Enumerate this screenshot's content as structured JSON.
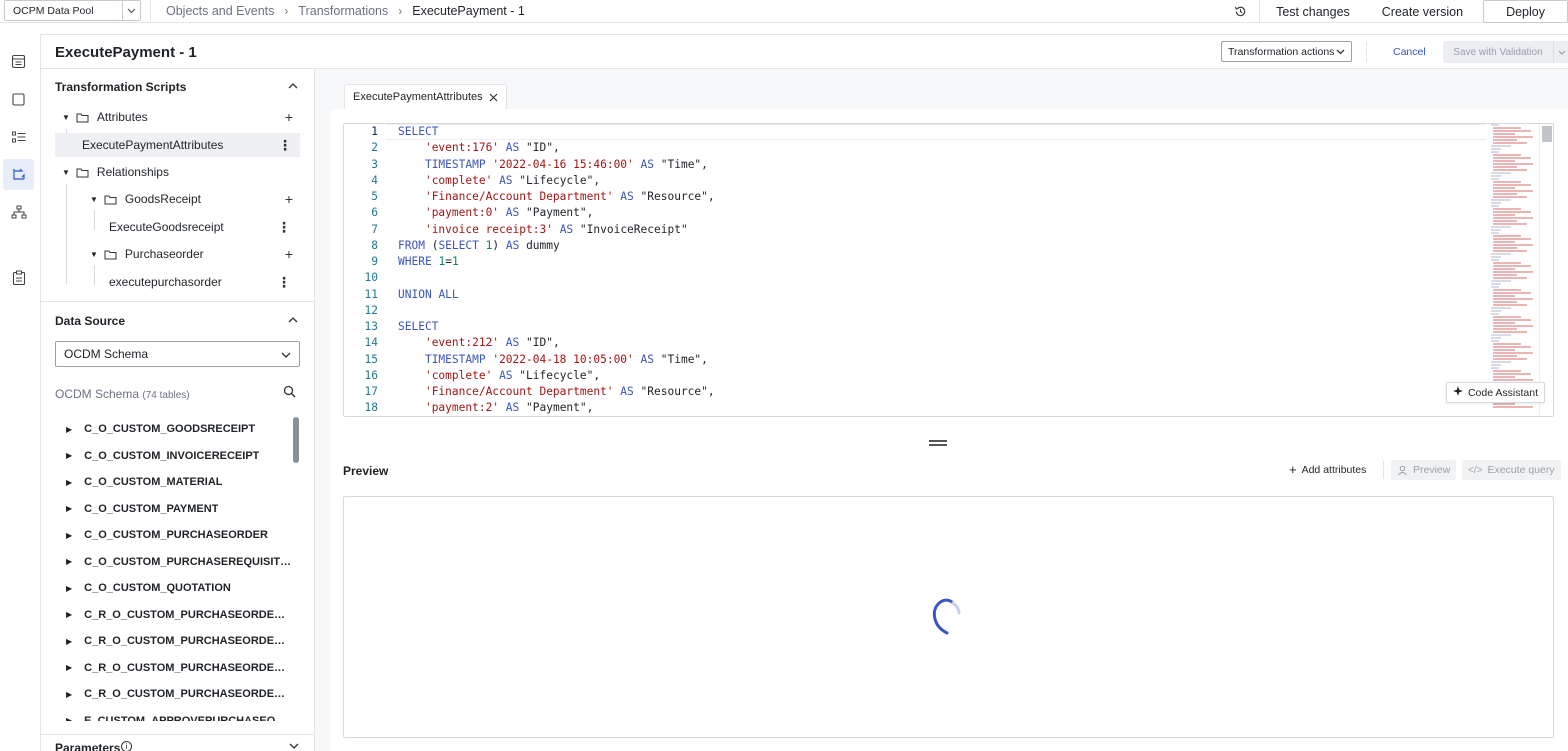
{
  "topbar": {
    "pool": "OCPM Data Pool",
    "breadcrumbs": [
      "Objects and Events",
      "Transformations",
      "ExecutePayment - 1"
    ],
    "actions": {
      "test": "Test changes",
      "create": "Create version",
      "deploy": "Deploy"
    }
  },
  "header": {
    "title": "ExecutePayment - 1",
    "transformation_actions": "Transformation actions",
    "cancel": "Cancel",
    "save": "Save with Validation"
  },
  "sidebar": {
    "scripts_title": "Transformation Scripts",
    "tree": {
      "attributes": "Attributes",
      "attr_item": "ExecutePaymentAttributes",
      "relationships": "Relationships",
      "goods_receipt": "GoodsReceipt",
      "goods_item": "ExecuteGoodsreceipt",
      "purchase_order": "Purchaseorder",
      "po_item": "executepurchasorder"
    },
    "data_source_title": "Data Source",
    "schema_select": "OCDM Schema",
    "schema_name": "OCDM Schema",
    "schema_count": "(74 tables)",
    "tables": [
      "C_O_CUSTOM_GOODSRECEIPT",
      "C_O_CUSTOM_INVOICERECEIPT",
      "C_O_CUSTOM_MATERIAL",
      "C_O_CUSTOM_PAYMENT",
      "C_O_CUSTOM_PURCHASEORDER",
      "C_O_CUSTOM_PURCHASEREQUISITI...",
      "C_O_CUSTOM_QUOTATION",
      "C_R_O_CUSTOM_PURCHASEORDER_...",
      "C_R_O_CUSTOM_PURCHASEORDER_...",
      "C_R_O_CUSTOM_PURCHASEORDER_...",
      "C_R_O_CUSTOM_PURCHASEORDER_...",
      "E_CUSTOM_APPROVEPURCHASEOR..."
    ],
    "parameters_title": "Parameters"
  },
  "editor": {
    "tab": "ExecutePaymentAttributes",
    "line_numbers": [
      "1",
      "2",
      "3",
      "4",
      "5",
      "6",
      "7",
      "8",
      "9",
      "10",
      "11",
      "12",
      "13",
      "14",
      "15",
      "16",
      "17",
      "18"
    ],
    "lines": [
      [
        {
          "t": "SELECT",
          "c": "kw"
        }
      ],
      [
        {
          "t": "    ",
          "c": ""
        },
        {
          "t": "'event:176'",
          "c": "str"
        },
        {
          "t": " ",
          "c": ""
        },
        {
          "t": "AS",
          "c": "kw"
        },
        {
          "t": " \"ID\",",
          "c": ""
        }
      ],
      [
        {
          "t": "    ",
          "c": ""
        },
        {
          "t": "TIMESTAMP",
          "c": "kw"
        },
        {
          "t": " ",
          "c": ""
        },
        {
          "t": "'2022-04-16 15:46:00'",
          "c": "str"
        },
        {
          "t": " ",
          "c": ""
        },
        {
          "t": "AS",
          "c": "kw"
        },
        {
          "t": " \"Time\",",
          "c": ""
        }
      ],
      [
        {
          "t": "    ",
          "c": ""
        },
        {
          "t": "'complete'",
          "c": "str"
        },
        {
          "t": " ",
          "c": ""
        },
        {
          "t": "AS",
          "c": "kw"
        },
        {
          "t": " \"Lifecycle\",",
          "c": ""
        }
      ],
      [
        {
          "t": "    ",
          "c": ""
        },
        {
          "t": "'Finance/Account Department'",
          "c": "str"
        },
        {
          "t": " ",
          "c": ""
        },
        {
          "t": "AS",
          "c": "kw"
        },
        {
          "t": " \"Resource\",",
          "c": ""
        }
      ],
      [
        {
          "t": "    ",
          "c": ""
        },
        {
          "t": "'payment:0'",
          "c": "str"
        },
        {
          "t": " ",
          "c": ""
        },
        {
          "t": "AS",
          "c": "kw"
        },
        {
          "t": " \"Payment\",",
          "c": ""
        }
      ],
      [
        {
          "t": "    ",
          "c": ""
        },
        {
          "t": "'invoice receipt:3'",
          "c": "str"
        },
        {
          "t": " ",
          "c": ""
        },
        {
          "t": "AS",
          "c": "kw"
        },
        {
          "t": " \"InvoiceReceipt\"",
          "c": ""
        }
      ],
      [
        {
          "t": "FROM",
          "c": "kw"
        },
        {
          "t": " (",
          "c": ""
        },
        {
          "t": "SELECT",
          "c": "kw"
        },
        {
          "t": " ",
          "c": ""
        },
        {
          "t": "1",
          "c": "num"
        },
        {
          "t": ") ",
          "c": ""
        },
        {
          "t": "AS",
          "c": "kw"
        },
        {
          "t": " dummy",
          "c": ""
        }
      ],
      [
        {
          "t": "WHERE",
          "c": "kw"
        },
        {
          "t": " ",
          "c": ""
        },
        {
          "t": "1",
          "c": "num"
        },
        {
          "t": "=",
          "c": ""
        },
        {
          "t": "1",
          "c": "num"
        }
      ],
      [],
      [
        {
          "t": "UNION",
          "c": "kw"
        },
        {
          "t": " ",
          "c": ""
        },
        {
          "t": "ALL",
          "c": "kw"
        }
      ],
      [],
      [
        {
          "t": "SELECT",
          "c": "kw"
        }
      ],
      [
        {
          "t": "    ",
          "c": ""
        },
        {
          "t": "'event:212'",
          "c": "str"
        },
        {
          "t": " ",
          "c": ""
        },
        {
          "t": "AS",
          "c": "kw"
        },
        {
          "t": " \"ID\",",
          "c": ""
        }
      ],
      [
        {
          "t": "    ",
          "c": ""
        },
        {
          "t": "TIMESTAMP",
          "c": "kw"
        },
        {
          "t": " ",
          "c": ""
        },
        {
          "t": "'2022-04-18 10:05:00'",
          "c": "str"
        },
        {
          "t": " ",
          "c": ""
        },
        {
          "t": "AS",
          "c": "kw"
        },
        {
          "t": " \"Time\",",
          "c": ""
        }
      ],
      [
        {
          "t": "    ",
          "c": ""
        },
        {
          "t": "'complete'",
          "c": "str"
        },
        {
          "t": " ",
          "c": ""
        },
        {
          "t": "AS",
          "c": "kw"
        },
        {
          "t": " \"Lifecycle\",",
          "c": ""
        }
      ],
      [
        {
          "t": "    ",
          "c": ""
        },
        {
          "t": "'Finance/Account Department'",
          "c": "str"
        },
        {
          "t": " ",
          "c": ""
        },
        {
          "t": "AS",
          "c": "kw"
        },
        {
          "t": " \"Resource\",",
          "c": ""
        }
      ],
      [
        {
          "t": "    ",
          "c": ""
        },
        {
          "t": "'payment:2'",
          "c": "str"
        },
        {
          "t": " ",
          "c": ""
        },
        {
          "t": "AS",
          "c": "kw"
        },
        {
          "t": " \"Payment\",",
          "c": ""
        }
      ]
    ],
    "code_assistant": "Code Assistant"
  },
  "preview": {
    "title": "Preview",
    "add_attributes": "Add attributes",
    "preview_btn": "Preview",
    "execute_btn": "Execute query"
  },
  "icons": {
    "history": "history-icon",
    "rail": [
      "table-icon",
      "square-icon",
      "list-icon",
      "transform-icon",
      "hierarchy-icon",
      "clipboard-icon"
    ]
  },
  "colors": {
    "accent": "#3156c7",
    "keyword": "#3c55b8",
    "string": "#a31515",
    "number": "#098658",
    "line_number": "#237893"
  }
}
